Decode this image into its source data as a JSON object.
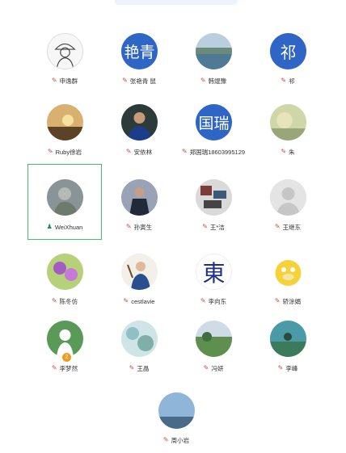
{
  "contacts": [
    {
      "name": "申逸群",
      "avatar_text": "",
      "icon": "pen-icon"
    },
    {
      "name": "张艳青 鼠",
      "avatar_text": "艳青",
      "icon": "pen-icon"
    },
    {
      "name": "韩焜豫",
      "avatar_text": "",
      "icon": "pen-icon"
    },
    {
      "name": "祁",
      "avatar_text": "祁",
      "icon": "pen-icon"
    },
    {
      "name": "Ruby徐岩",
      "avatar_text": "",
      "icon": "pen-icon"
    },
    {
      "name": "安依林",
      "avatar_text": "",
      "icon": "pen-icon"
    },
    {
      "name": "郑国瑞18603995129",
      "avatar_text": "国瑞",
      "icon": "pen-icon"
    },
    {
      "name": "朱",
      "avatar_text": "",
      "icon": "pen-icon"
    },
    {
      "name": "WeiXhuan",
      "avatar_text": "",
      "icon": "user-icon"
    },
    {
      "name": "孙寅生",
      "avatar_text": "",
      "icon": "pen-icon"
    },
    {
      "name": "王*洁",
      "avatar_text": "",
      "icon": "pen-icon"
    },
    {
      "name": "王继东",
      "avatar_text": "",
      "icon": "pen-icon"
    },
    {
      "name": "陈冬仿",
      "avatar_text": "",
      "icon": "pen-icon"
    },
    {
      "name": "cestlavie",
      "avatar_text": "",
      "icon": "pen-icon"
    },
    {
      "name": "李向东",
      "avatar_text": "東",
      "icon": "pen-icon"
    },
    {
      "name": "轿涂娟",
      "avatar_text": "",
      "icon": "pen-icon"
    },
    {
      "name": "李梦然",
      "avatar_text": "",
      "icon": "pen-icon"
    },
    {
      "name": "王晶",
      "avatar_text": "",
      "icon": "pen-icon"
    },
    {
      "name": "冯妍",
      "avatar_text": "",
      "icon": "pen-icon"
    },
    {
      "name": "李峰",
      "avatar_text": "",
      "icon": "pen-icon"
    },
    {
      "name": "周小岩",
      "avatar_text": "",
      "icon": "pen-icon"
    }
  ],
  "badge_text": "2",
  "selected_name": "WeiXhuan"
}
